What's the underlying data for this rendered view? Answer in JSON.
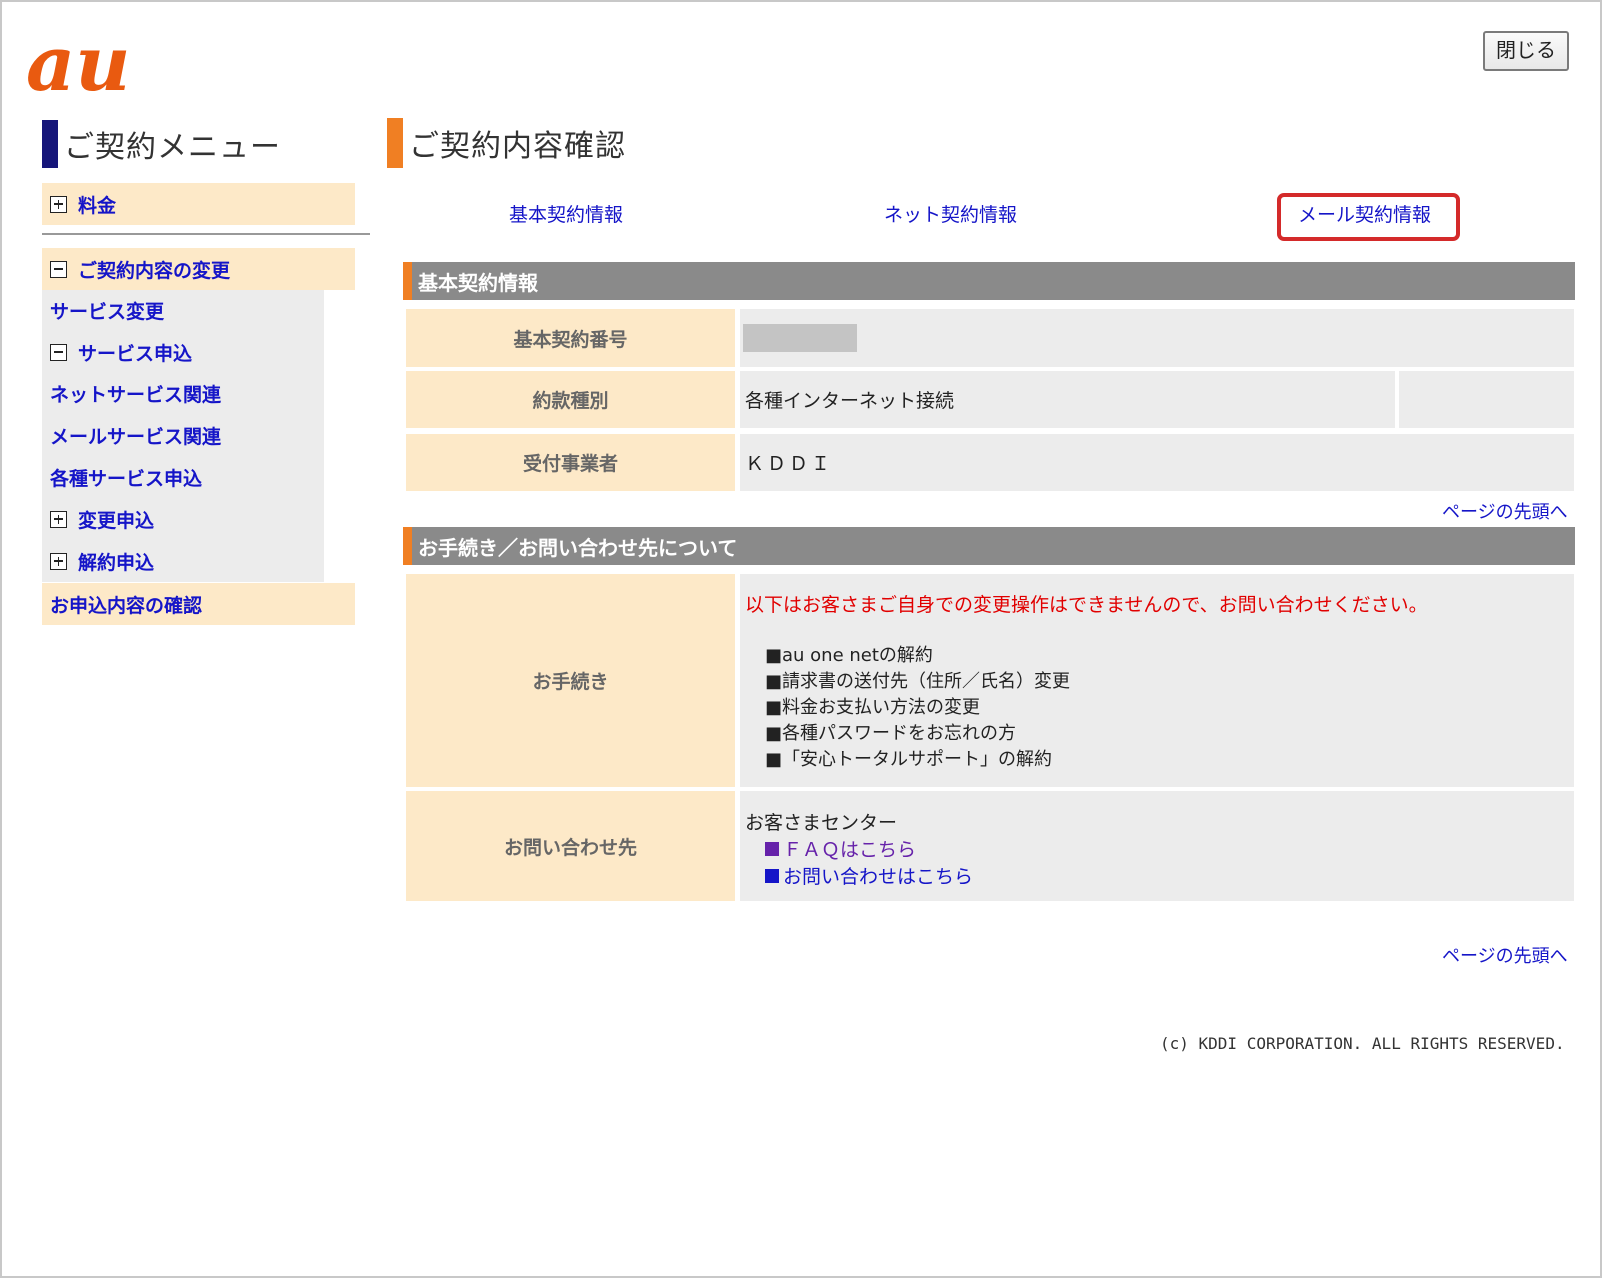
{
  "header": {
    "logo_text": "au",
    "close_button": "閉じる",
    "brand_color": "#e95a10"
  },
  "sidebar": {
    "title": "ご契約メニュー",
    "items": [
      {
        "label": "料金",
        "icon": "plus-box-icon"
      },
      {
        "label": "ご契約内容の変更",
        "icon": "minus-box-icon"
      },
      {
        "label": "サービス変更"
      },
      {
        "label": "サービス申込",
        "icon": "minus-box-icon"
      },
      {
        "label": "ネットサービス関連"
      },
      {
        "label": "メールサービス関連"
      },
      {
        "label": "各種サービス申込"
      },
      {
        "label": "変更申込",
        "icon": "plus-box-icon"
      },
      {
        "label": "解約申込",
        "icon": "plus-box-icon"
      },
      {
        "label": "お申込内容の確認"
      }
    ]
  },
  "main": {
    "title": "ご契約内容確認",
    "tabs": [
      "基本契約情報",
      "ネット契約情報",
      "メール契約情報"
    ],
    "basic_section": {
      "heading": "基本契約情報",
      "rows": [
        {
          "label": "基本契約番号",
          "value": ""
        },
        {
          "label": "約款種別",
          "value": "各種インターネット接続"
        },
        {
          "label": "受付事業者",
          "value": "ＫＤＤＩ"
        }
      ]
    },
    "page_top": "ページの先頭へ",
    "contact_section": {
      "heading": "お手続き／お問い合わせ先について",
      "procedure_label": "お手続き",
      "notice": "以下はお客さまご自身での変更操作はできませんので、お問い合わせください。",
      "procedures": [
        "■au one netの解約",
        "■請求書の送付先（住所／氏名）変更",
        "■料金お支払い方法の変更",
        "■各種パスワードをお忘れの方",
        "■「安心トータルサポート」の解約"
      ],
      "contact_label": "お問い合わせ先",
      "center_name": "お客さまセンター",
      "faq_link": "ＦＡＱはこちら",
      "inquiry_link": "お問い合わせはこちら"
    },
    "page_top_2": "ページの先頭へ"
  },
  "footer": {
    "copyright": "(c) KDDI CORPORATION. ALL RIGHTS RESERVED."
  }
}
